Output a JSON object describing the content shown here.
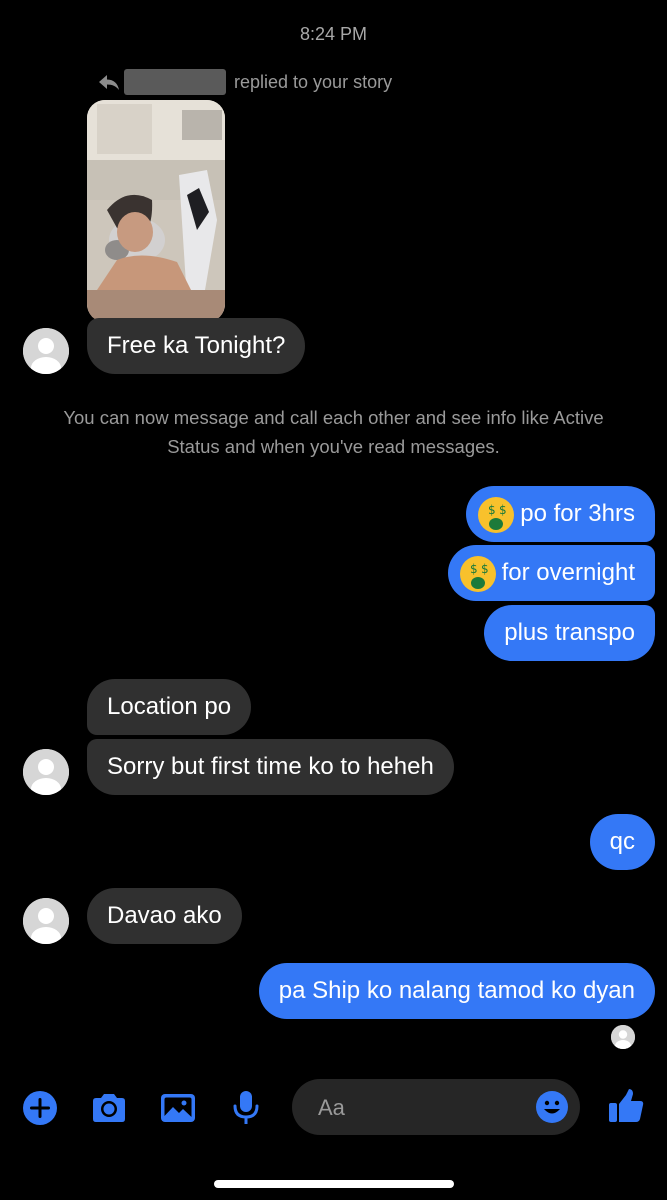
{
  "header": {
    "time": "8:24 PM"
  },
  "story_reply": {
    "text": "replied to your story"
  },
  "messages": {
    "m1": "Free ka Tonight?",
    "info": "You can now message and call each other and see info like Active Status and when you've read messages.",
    "m2": "po for 3hrs",
    "m3": "for overnight",
    "m4": "plus transpo",
    "m5": "Location po",
    "m6": "Sorry but first time ko to heheh",
    "m7": "qc",
    "m8": "Davao ako",
    "m9": "pa Ship ko nalang tamod ko dyan"
  },
  "composer": {
    "placeholder": "Aa"
  },
  "icons": {
    "toolbar": [
      "plus-icon",
      "camera-icon",
      "photo-icon",
      "microphone-icon",
      "emoji-icon",
      "thumbs-up-icon"
    ],
    "inline": "money-mouth-face-emoji"
  },
  "colors": {
    "accent": "#3478f6",
    "incoming_bubble": "#303030",
    "background": "#000000"
  }
}
